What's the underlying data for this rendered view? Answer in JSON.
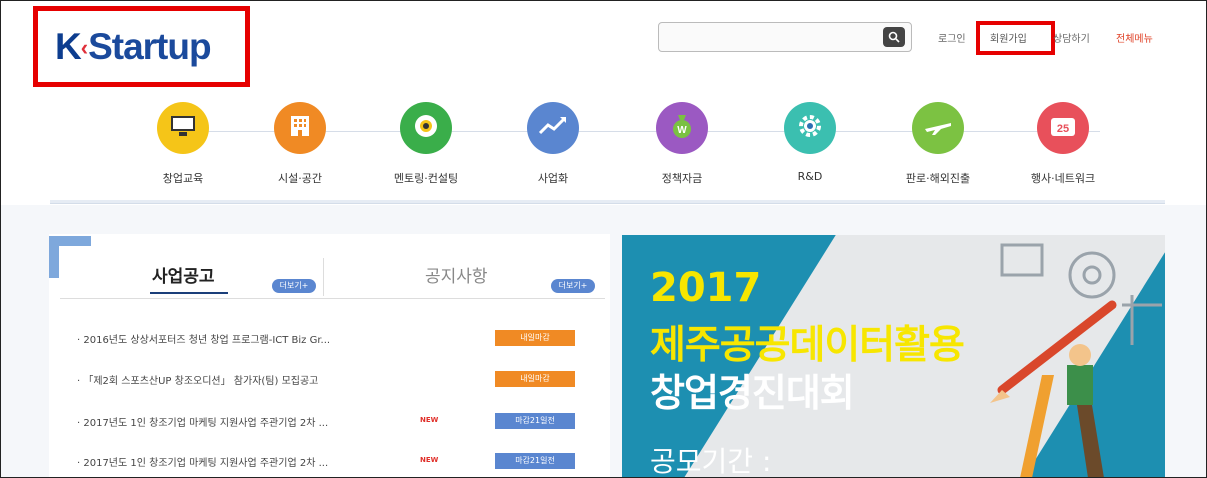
{
  "header": {
    "logo": {
      "k": "K",
      "arrow": "‹",
      "rest": "Startup"
    },
    "search": {
      "placeholder": "",
      "icon": "search-icon"
    },
    "nav": {
      "login": "로그인",
      "join": "회원가입",
      "consult": "상담하기",
      "all_menu": "전체메뉴"
    }
  },
  "categories": [
    {
      "label": "창업교육",
      "color": "#f5c518",
      "icon": "monitor-icon"
    },
    {
      "label": "시설·공간",
      "color": "#f08a24",
      "icon": "building-icon"
    },
    {
      "label": "멘토링·컨설팅",
      "color": "#3aae4a",
      "icon": "eye-icon"
    },
    {
      "label": "사업화",
      "color": "#5a86d0",
      "icon": "growth-chart-icon"
    },
    {
      "label": "정책자금",
      "color": "#9b59c2",
      "icon": "money-bag-icon"
    },
    {
      "label": "R&D",
      "color": "#3bbfb0",
      "icon": "gear-icon"
    },
    {
      "label": "판로·해외진출",
      "color": "#7cc242",
      "icon": "airplane-icon"
    },
    {
      "label": "행사·네트워크",
      "color": "#e8505b",
      "icon": "calendar-icon"
    }
  ],
  "notices": {
    "tab_business": "사업공고",
    "tab_notice": "공지사항",
    "more": "더보기+",
    "items": [
      {
        "text": "· 2016년도 상상서포터즈 청년 창업 프로그램-ICT Biz Gr...",
        "new": "",
        "badge": "내일마감",
        "badge_color": "orange"
      },
      {
        "text": "· 「제2회 스포츠산UP 창조오디션」 참가자(팀) 모집공고",
        "new": "",
        "badge": "내일마감",
        "badge_color": "orange"
      },
      {
        "text": "· 2017년도 1인 창조기업 마케팅 지원사업 주관기업 2차 ...",
        "new": "NEW",
        "badge": "마감21일전",
        "badge_color": "blue"
      },
      {
        "text": "· 2017년도 1인 창조기업 마케팅 지원사업 주관기업 2차 ...",
        "new": "NEW",
        "badge": "마감21일전",
        "badge_color": "blue"
      }
    ]
  },
  "banner": {
    "year": "2017",
    "title": "제주공공데이터활용",
    "subtitle": "창업경진대회",
    "period": "공모기간 :"
  }
}
